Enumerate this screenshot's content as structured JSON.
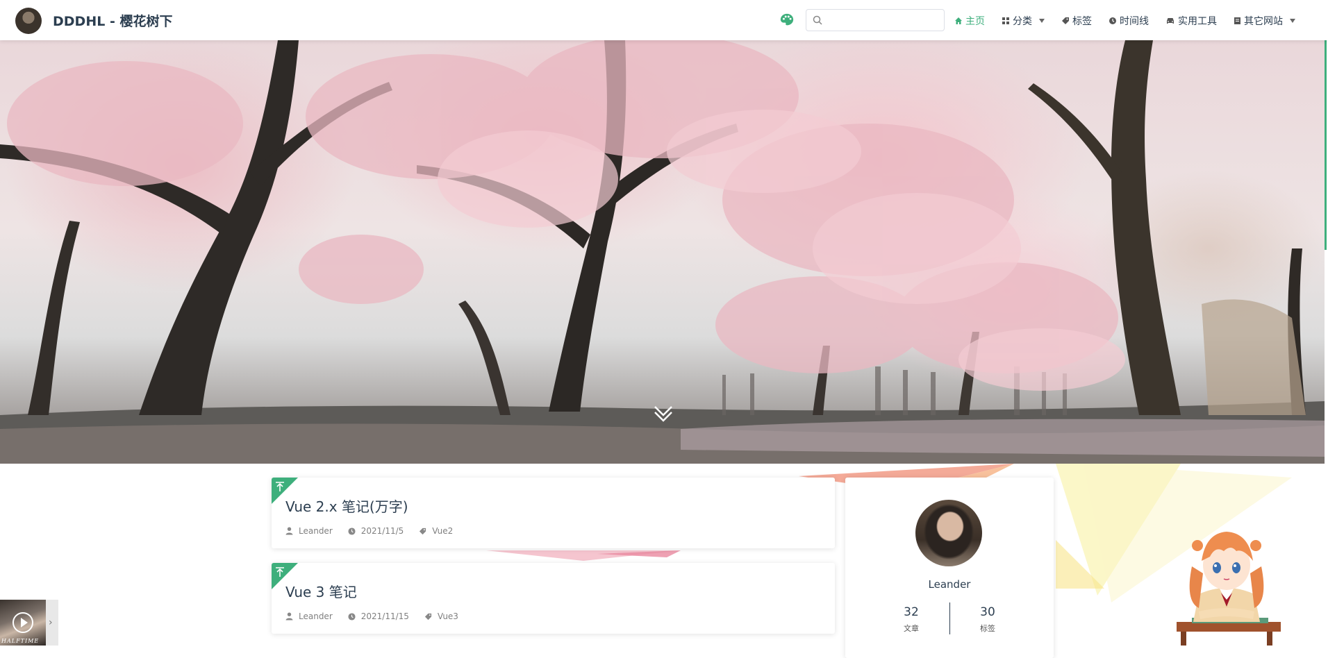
{
  "header": {
    "site_name": "DDDHL - 樱花树下",
    "search_placeholder": "",
    "nav": [
      {
        "label": "主页",
        "icon": "home-icon",
        "active": true
      },
      {
        "label": "分类",
        "icon": "grid-icon",
        "dropdown": true
      },
      {
        "label": "标签",
        "icon": "tag-icon"
      },
      {
        "label": "时间线",
        "icon": "clock-icon"
      },
      {
        "label": "实用工具",
        "icon": "car-icon"
      },
      {
        "label": "其它网站",
        "icon": "book-icon",
        "dropdown": true
      }
    ]
  },
  "posts": [
    {
      "title": "Vue 2.x 笔记(万字)",
      "author": "Leander",
      "date": "2021/11/5",
      "tag": "Vue2",
      "pinned": true
    },
    {
      "title": "Vue 3 笔记",
      "author": "Leander",
      "date": "2021/11/15",
      "tag": "Vue3",
      "pinned": true
    }
  ],
  "profile": {
    "name": "Leander",
    "articles_count": "32",
    "articles_label": "文章",
    "tags_count": "30",
    "tags_label": "标签"
  },
  "player": {
    "cover_text": "HALFTIME"
  },
  "colors": {
    "accent": "#3eaf7c",
    "text": "#2c3e50",
    "meta": "#7f7f7f"
  }
}
